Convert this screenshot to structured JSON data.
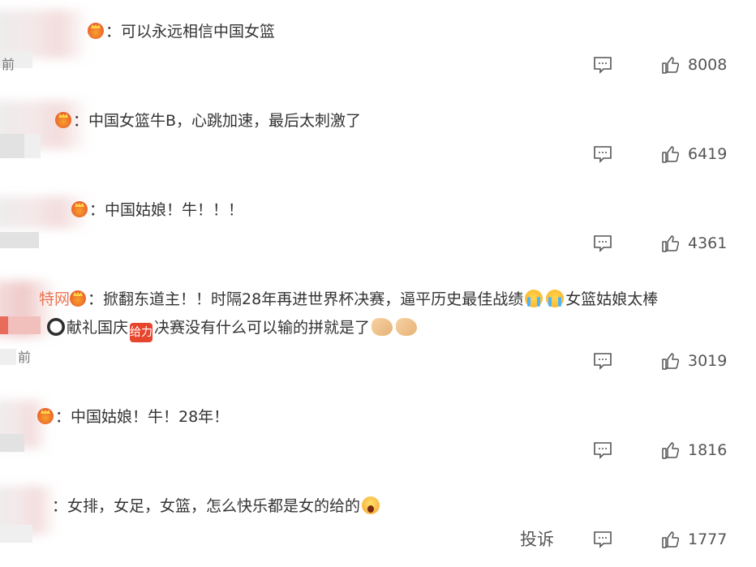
{
  "comments": [
    {
      "username_tail": "",
      "segments": {
        "t1": "：可以永远相信中国女篮"
      },
      "likes": "8008",
      "meta_fragment": "前"
    },
    {
      "username_tail": "",
      "segments": {
        "t1": "：中国女篮牛B，心跳加速，最后太刺激了"
      },
      "likes": "6419",
      "meta_fragment": ""
    },
    {
      "username_tail": "",
      "segments": {
        "t1": "：中国姑娘！牛！！！"
      },
      "likes": "4361",
      "meta_fragment": ""
    },
    {
      "username_tail": "特网",
      "segments": {
        "t1": "：掀翻东道主！！时隔28年再进世界杯决赛，逼平历史最佳战绩",
        "t2": "女篮姑娘太棒",
        "t3": "献礼国庆",
        "sticker": "给力",
        "t4": "决赛没有什么可以输的拼就是了"
      },
      "likes": "3019",
      "meta_fragment": "前"
    },
    {
      "username_tail": "",
      "segments": {
        "t1": "：中国姑娘！牛！28年！"
      },
      "likes": "1816",
      "meta_fragment": ""
    },
    {
      "username_tail": "",
      "segments": {
        "t1": "：女排，女足，女篮，怎么快乐都是女的给的"
      },
      "likes": "1777",
      "meta_fragment": "",
      "report_label": "投诉"
    }
  ],
  "icons": {
    "reply": "comment-reply-icon",
    "like": "thumbs-up-icon",
    "badge": "crown-badge-icon"
  },
  "colors": {
    "text": "#333333",
    "meta": "#555555",
    "username": "#eb7350"
  }
}
